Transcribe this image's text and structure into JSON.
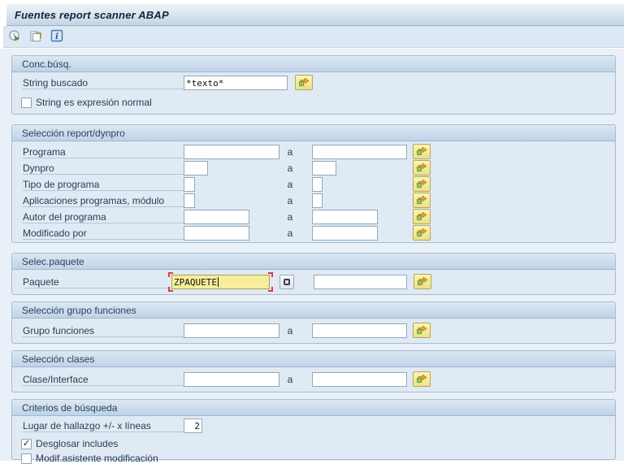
{
  "ui": {
    "title": "Fuentes report scanner ABAP",
    "range_separator": "a",
    "check_glyph": "✓",
    "toolbar_icons": [
      "execute-icon",
      "get-variant-icon",
      "info-icon"
    ]
  },
  "groups": {
    "search": {
      "title": "Conc.búsq.",
      "string_label": "String buscado",
      "string_value": "*texto*",
      "regex_label": "String es expresión normal",
      "regex_checked": false
    },
    "report": {
      "title": "Selección report/dynpro",
      "rows": [
        {
          "label": "Programa",
          "from_value": "",
          "to_value": ""
        },
        {
          "label": "Dynpro",
          "from_value": "",
          "to_value": ""
        },
        {
          "label": "Tipo de programa",
          "from_value": "",
          "to_value": ""
        },
        {
          "label": "Aplicaciones programas, módulo",
          "from_value": "",
          "to_value": ""
        },
        {
          "label": "Autor del programa",
          "from_value": "",
          "to_value": ""
        },
        {
          "label": "Modificado por",
          "from_value": "",
          "to_value": ""
        }
      ]
    },
    "package": {
      "title": "Selec.paquete",
      "label": "Paquete",
      "value": "ZPAQUETE",
      "to_value": ""
    },
    "function_group": {
      "title": "Selección grupo funciones",
      "label": "Grupo funciones",
      "from_value": "",
      "to_value": ""
    },
    "classes": {
      "title": "Selección clases",
      "label": "Clase/Interface",
      "from_value": "",
      "to_value": ""
    },
    "criteria": {
      "title": "Criterios de búsqueda",
      "hit_label": "Lugar de hallazgo +/- x líneas",
      "hit_value": "2",
      "includes_label": "Desglosar includes",
      "includes_checked": true,
      "modif_label": "Modif.asistente modificación",
      "modif_checked": false
    }
  },
  "colors": {
    "group_body": "#e0eaf4",
    "group_header_top": "#dce8f3",
    "group_header_bottom": "#bfd3e7",
    "focus_field_bg": "#f7ee9b",
    "focus_frame": "#d8413c",
    "msel_button_bg": "#f3e89f",
    "titlebar_bottom": "#c2d4e5",
    "content_bg": "#e9f0f7"
  }
}
